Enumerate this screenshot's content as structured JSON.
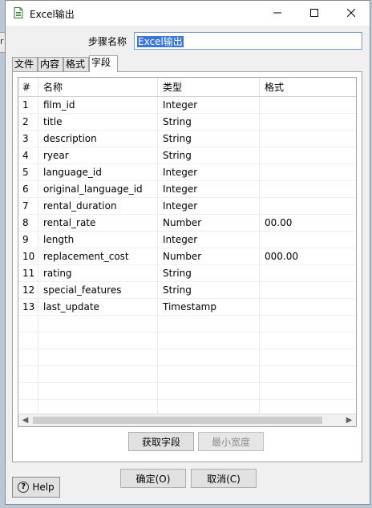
{
  "background": {
    "left_edge_text": "r"
  },
  "window": {
    "title": "Excel输出",
    "icons": {
      "app": "document-icon",
      "minimize": "minimize-icon",
      "maximize": "maximize-icon",
      "close": "close-icon"
    }
  },
  "step": {
    "label": "步骤名称",
    "value": "Excel输出"
  },
  "tabs": [
    {
      "label": "文件",
      "active": false
    },
    {
      "label": "内容",
      "active": false
    },
    {
      "label": "格式",
      "active": false
    },
    {
      "label": "字段",
      "active": true
    }
  ],
  "fields_table": {
    "headers": [
      "#",
      "名称",
      "类型",
      "格式"
    ],
    "rows": [
      {
        "num": "1",
        "name": "film_id",
        "type": "Integer",
        "format": ""
      },
      {
        "num": "2",
        "name": "title",
        "type": "String",
        "format": ""
      },
      {
        "num": "3",
        "name": "description",
        "type": "String",
        "format": ""
      },
      {
        "num": "4",
        "name": "ryear",
        "type": "String",
        "format": ""
      },
      {
        "num": "5",
        "name": "language_id",
        "type": "Integer",
        "format": ""
      },
      {
        "num": "6",
        "name": "original_language_id",
        "type": "Integer",
        "format": ""
      },
      {
        "num": "7",
        "name": "rental_duration",
        "type": "Integer",
        "format": ""
      },
      {
        "num": "8",
        "name": "rental_rate",
        "type": "Number",
        "format": "00.00"
      },
      {
        "num": "9",
        "name": "length",
        "type": "Integer",
        "format": ""
      },
      {
        "num": "10",
        "name": "replacement_cost",
        "type": "Number",
        "format": "000.00"
      },
      {
        "num": "11",
        "name": "rating",
        "type": "String",
        "format": ""
      },
      {
        "num": "12",
        "name": "special_features",
        "type": "String",
        "format": ""
      },
      {
        "num": "13",
        "name": "last_update",
        "type": "Timestamp",
        "format": ""
      }
    ],
    "empty_rows": 6
  },
  "buttons": {
    "get_fields": "获取字段",
    "min_width": "最小宽度",
    "ok": "确定(O)",
    "cancel": "取消(C)",
    "help": "Help"
  }
}
